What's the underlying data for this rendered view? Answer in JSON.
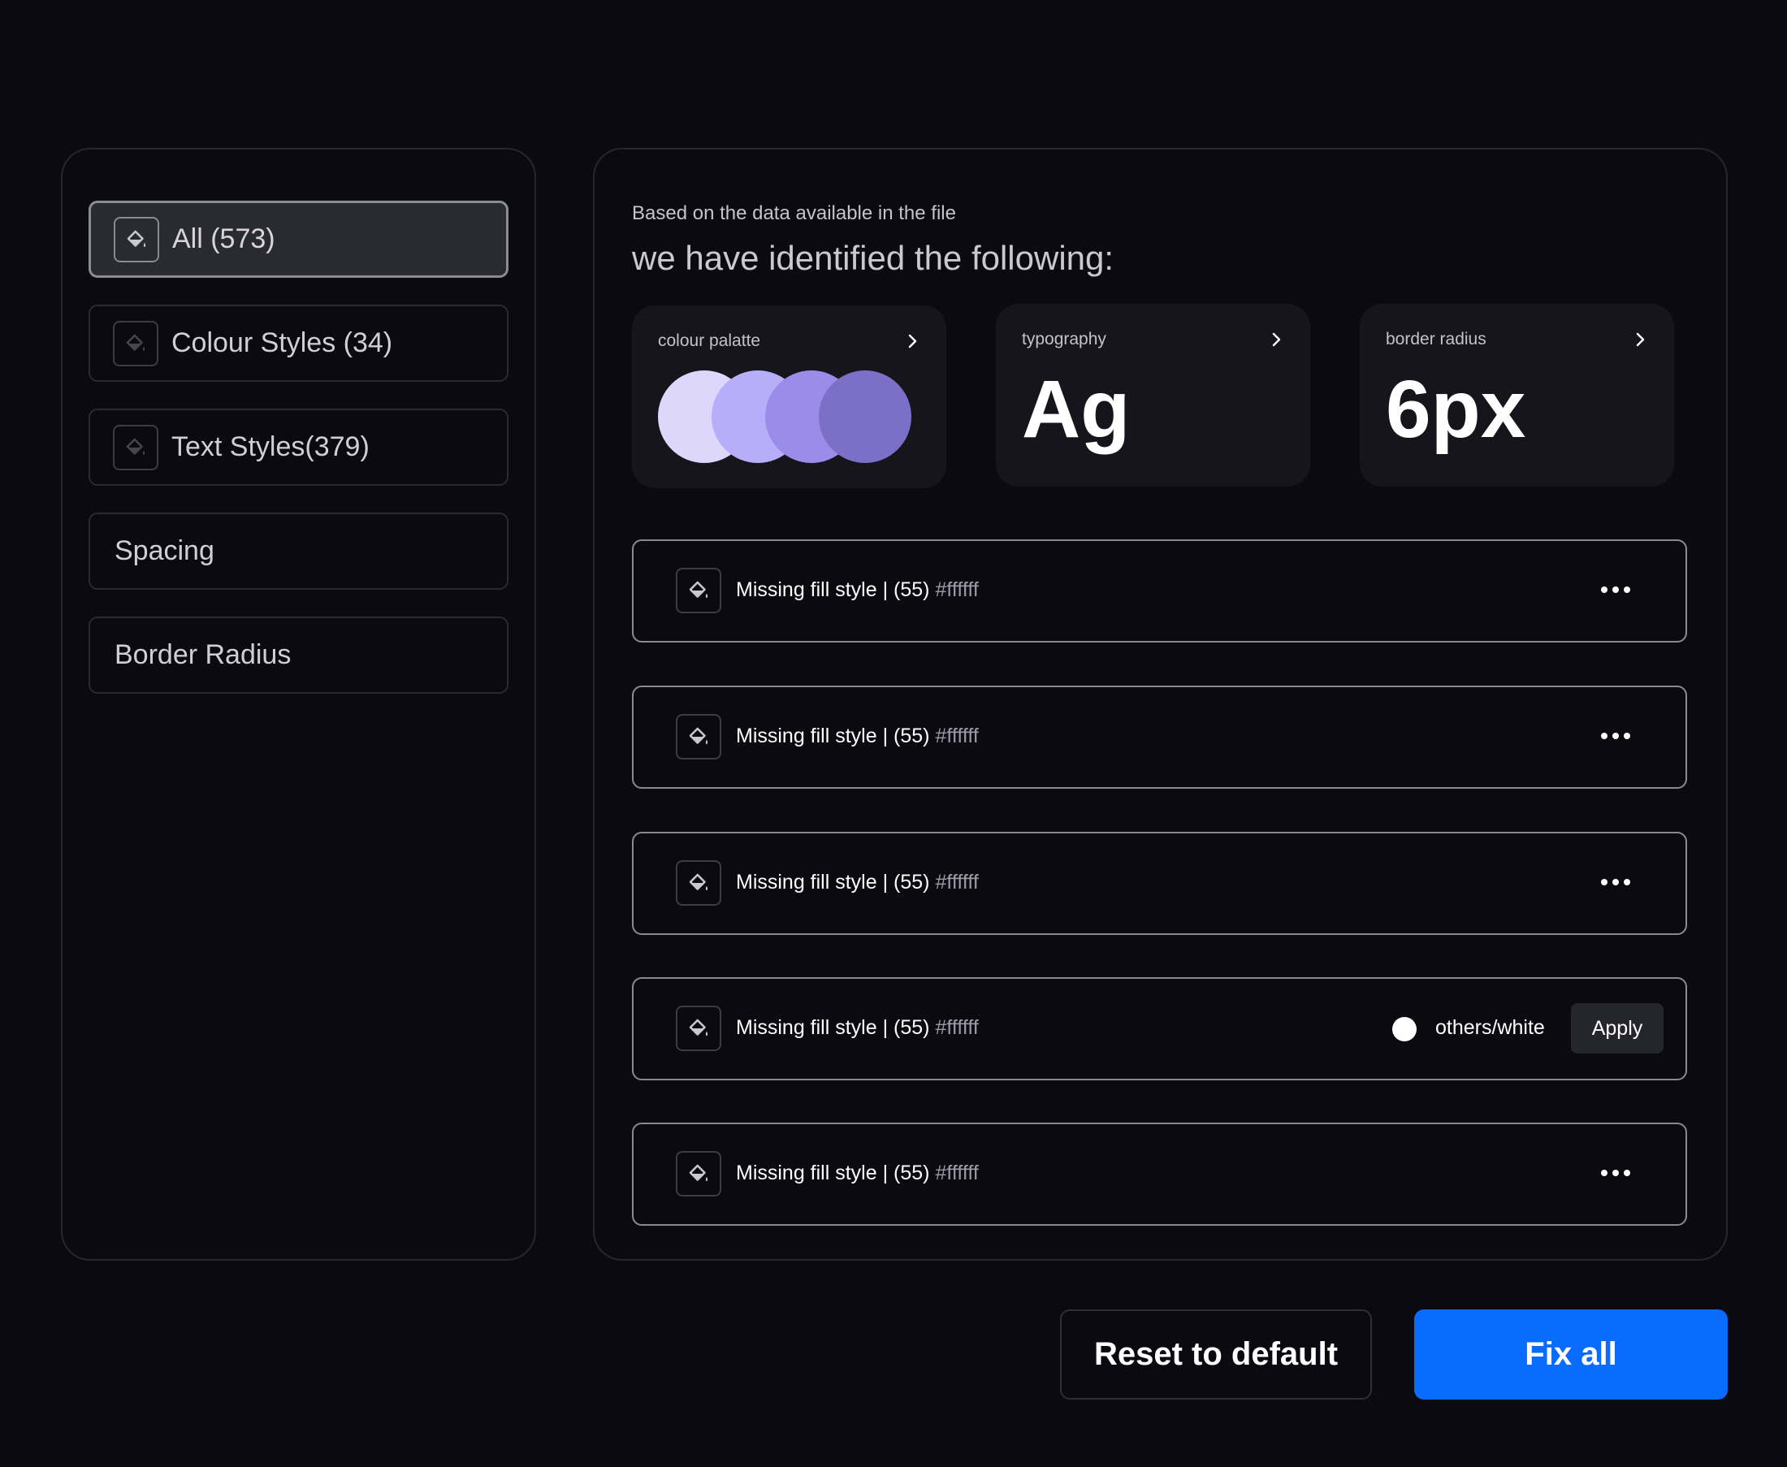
{
  "sidebar": {
    "items": [
      {
        "label": "All (573)",
        "icon": "paint-bucket-icon",
        "active": true
      },
      {
        "label": "Colour Styles (34)",
        "icon": "paint-bucket-icon",
        "active": false
      },
      {
        "label": "Text Styles(379)",
        "icon": "paint-bucket-icon",
        "active": false
      },
      {
        "label": "Spacing",
        "active": false
      },
      {
        "label": "Border Radius",
        "active": false
      }
    ]
  },
  "main": {
    "subtitle": "Based on the data available in the file",
    "headline": "we have identified the following:",
    "cards": {
      "palette": {
        "label": "colour palatte",
        "swatches": [
          "#dcd7fb",
          "#b7aefa",
          "#9a8ce8",
          "#7b6fc8"
        ]
      },
      "typography": {
        "label": "typography",
        "sample": "Ag"
      },
      "radius": {
        "label": "border radius",
        "value": "6px"
      }
    },
    "issues": [
      {
        "title": "Missing fill style | (55)",
        "hex": "#ffffff"
      },
      {
        "title": "Missing fill style | (55)",
        "hex": "#ffffff"
      },
      {
        "title": "Missing fill style | (55)",
        "hex": "#ffffff"
      },
      {
        "title": "Missing fill style | (55)",
        "hex": "#ffffff",
        "suggestion": "others/white",
        "apply_label": "Apply"
      },
      {
        "title": "Missing fill style | (55)",
        "hex": "#ffffff"
      }
    ]
  },
  "footer": {
    "reset_label": "Reset to default",
    "fix_label": "Fix all"
  },
  "colors": {
    "background": "#0a0a10",
    "accent": "#0a6bff",
    "card": "#15151b"
  }
}
